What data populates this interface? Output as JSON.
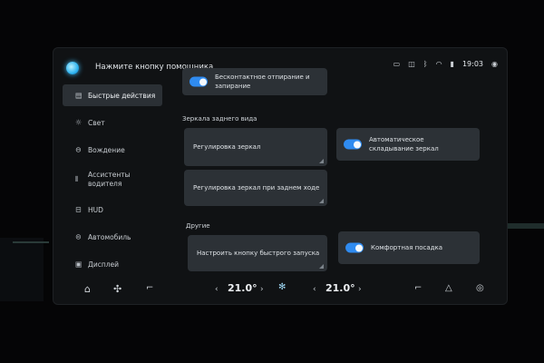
{
  "assistant": {
    "prompt": "Нажмите кнопку помощника"
  },
  "status": {
    "time": "19:03"
  },
  "sidebar": {
    "items": [
      {
        "label": "Быстрые действия",
        "icon": "quick-actions-icon"
      },
      {
        "label": "Свет",
        "icon": "light-icon"
      },
      {
        "label": "Вождение",
        "icon": "steering-wheel-icon"
      },
      {
        "label": "Ассистенты водителя",
        "icon": "driver-assist-icon"
      },
      {
        "label": "HUD",
        "icon": "hud-icon"
      },
      {
        "label": "Автомобиль",
        "icon": "car-icon"
      },
      {
        "label": "Дисплей",
        "icon": "display-icon"
      }
    ]
  },
  "main": {
    "top_card": {
      "label": "Бесконтактное отпирание и запирание",
      "toggle_on": true
    },
    "mirrors_section": "Зеркала заднего вида",
    "mirror_adjust": "Регулировка зеркал",
    "auto_fold": {
      "label": "Автоматическое складывание зеркал",
      "toggle_on": true
    },
    "mirror_reverse": "Регулировка зеркал при заднем ходе",
    "other_section": "Другие",
    "quick_button": "Настроить кнопку быстрого запуска",
    "comfort_entry": {
      "label": "Комфортная посадка",
      "toggle_on": true
    }
  },
  "climate": {
    "left_temp": "21.0°",
    "right_temp": "21.0°"
  },
  "colors": {
    "accent": "#2f8bf0",
    "background": "#101214",
    "card": "#2c3136"
  }
}
